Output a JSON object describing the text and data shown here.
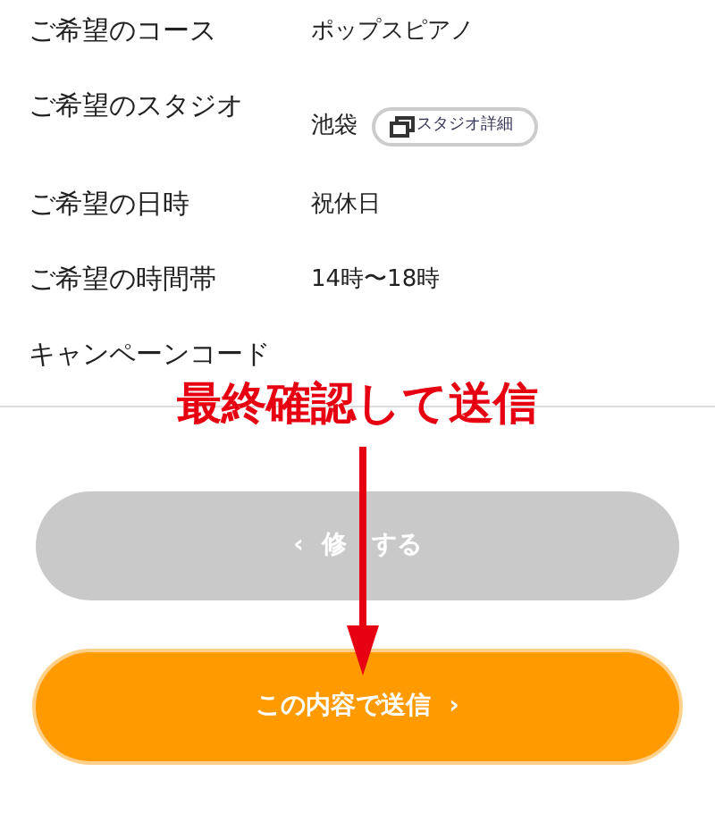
{
  "rows": [
    {
      "label": "ご希望のコース",
      "value": "ポップスピアノ"
    },
    {
      "label": "ご希望のスタジオ",
      "value": "池袋",
      "link": "スタジオ詳細"
    },
    {
      "label": "ご希望の日時",
      "value": "祝休日"
    },
    {
      "label": "ご希望の時間帯",
      "value": "14時〜18時"
    },
    {
      "label": "キャンペーンコード"
    }
  ],
  "annotation": "最終確認して送信",
  "buttons": [
    {
      "kind": "back",
      "label_parts": [
        "修",
        "する"
      ],
      "icon": "‹"
    },
    {
      "kind": "submit",
      "label": "この内容で送信",
      "icon": "›"
    }
  ]
}
